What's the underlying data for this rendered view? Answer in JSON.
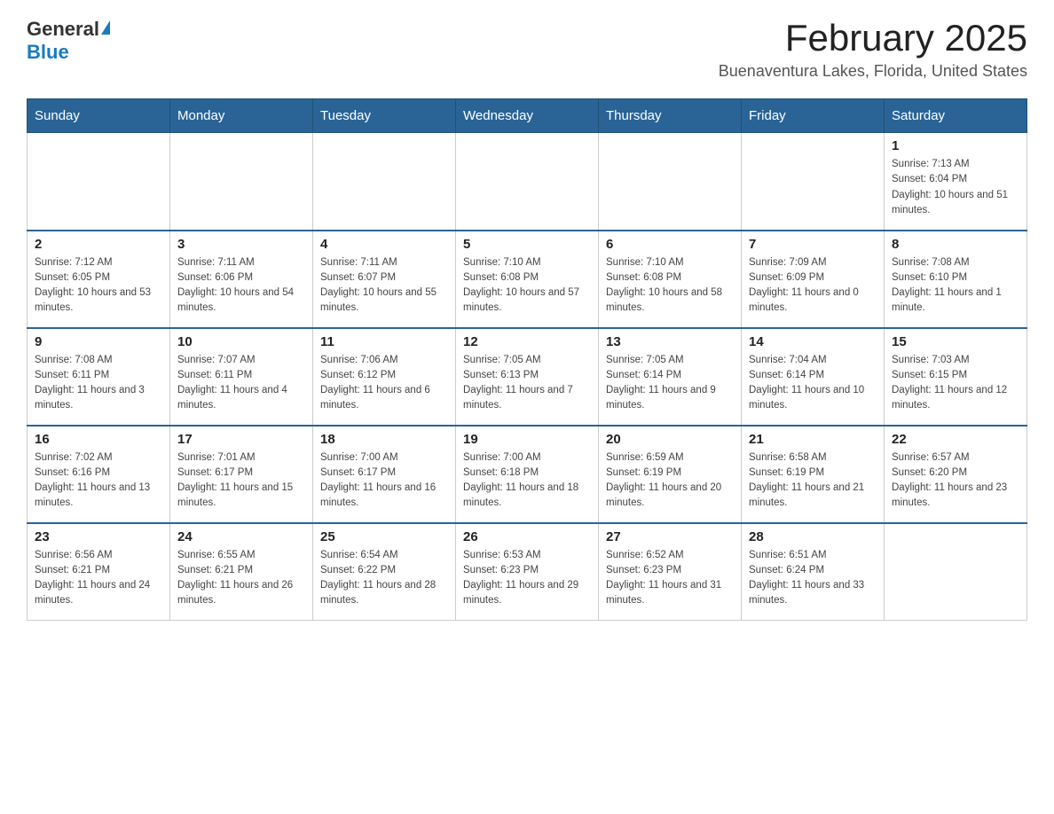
{
  "header": {
    "logo_general": "General",
    "logo_blue": "Blue",
    "title": "February 2025",
    "subtitle": "Buenaventura Lakes, Florida, United States"
  },
  "days_of_week": [
    "Sunday",
    "Monday",
    "Tuesday",
    "Wednesday",
    "Thursday",
    "Friday",
    "Saturday"
  ],
  "weeks": [
    [
      {
        "day": "",
        "sunrise": "",
        "sunset": "",
        "daylight": ""
      },
      {
        "day": "",
        "sunrise": "",
        "sunset": "",
        "daylight": ""
      },
      {
        "day": "",
        "sunrise": "",
        "sunset": "",
        "daylight": ""
      },
      {
        "day": "",
        "sunrise": "",
        "sunset": "",
        "daylight": ""
      },
      {
        "day": "",
        "sunrise": "",
        "sunset": "",
        "daylight": ""
      },
      {
        "day": "",
        "sunrise": "",
        "sunset": "",
        "daylight": ""
      },
      {
        "day": "1",
        "sunrise": "Sunrise: 7:13 AM",
        "sunset": "Sunset: 6:04 PM",
        "daylight": "Daylight: 10 hours and 51 minutes."
      }
    ],
    [
      {
        "day": "2",
        "sunrise": "Sunrise: 7:12 AM",
        "sunset": "Sunset: 6:05 PM",
        "daylight": "Daylight: 10 hours and 53 minutes."
      },
      {
        "day": "3",
        "sunrise": "Sunrise: 7:11 AM",
        "sunset": "Sunset: 6:06 PM",
        "daylight": "Daylight: 10 hours and 54 minutes."
      },
      {
        "day": "4",
        "sunrise": "Sunrise: 7:11 AM",
        "sunset": "Sunset: 6:07 PM",
        "daylight": "Daylight: 10 hours and 55 minutes."
      },
      {
        "day": "5",
        "sunrise": "Sunrise: 7:10 AM",
        "sunset": "Sunset: 6:08 PM",
        "daylight": "Daylight: 10 hours and 57 minutes."
      },
      {
        "day": "6",
        "sunrise": "Sunrise: 7:10 AM",
        "sunset": "Sunset: 6:08 PM",
        "daylight": "Daylight: 10 hours and 58 minutes."
      },
      {
        "day": "7",
        "sunrise": "Sunrise: 7:09 AM",
        "sunset": "Sunset: 6:09 PM",
        "daylight": "Daylight: 11 hours and 0 minutes."
      },
      {
        "day": "8",
        "sunrise": "Sunrise: 7:08 AM",
        "sunset": "Sunset: 6:10 PM",
        "daylight": "Daylight: 11 hours and 1 minute."
      }
    ],
    [
      {
        "day": "9",
        "sunrise": "Sunrise: 7:08 AM",
        "sunset": "Sunset: 6:11 PM",
        "daylight": "Daylight: 11 hours and 3 minutes."
      },
      {
        "day": "10",
        "sunrise": "Sunrise: 7:07 AM",
        "sunset": "Sunset: 6:11 PM",
        "daylight": "Daylight: 11 hours and 4 minutes."
      },
      {
        "day": "11",
        "sunrise": "Sunrise: 7:06 AM",
        "sunset": "Sunset: 6:12 PM",
        "daylight": "Daylight: 11 hours and 6 minutes."
      },
      {
        "day": "12",
        "sunrise": "Sunrise: 7:05 AM",
        "sunset": "Sunset: 6:13 PM",
        "daylight": "Daylight: 11 hours and 7 minutes."
      },
      {
        "day": "13",
        "sunrise": "Sunrise: 7:05 AM",
        "sunset": "Sunset: 6:14 PM",
        "daylight": "Daylight: 11 hours and 9 minutes."
      },
      {
        "day": "14",
        "sunrise": "Sunrise: 7:04 AM",
        "sunset": "Sunset: 6:14 PM",
        "daylight": "Daylight: 11 hours and 10 minutes."
      },
      {
        "day": "15",
        "sunrise": "Sunrise: 7:03 AM",
        "sunset": "Sunset: 6:15 PM",
        "daylight": "Daylight: 11 hours and 12 minutes."
      }
    ],
    [
      {
        "day": "16",
        "sunrise": "Sunrise: 7:02 AM",
        "sunset": "Sunset: 6:16 PM",
        "daylight": "Daylight: 11 hours and 13 minutes."
      },
      {
        "day": "17",
        "sunrise": "Sunrise: 7:01 AM",
        "sunset": "Sunset: 6:17 PM",
        "daylight": "Daylight: 11 hours and 15 minutes."
      },
      {
        "day": "18",
        "sunrise": "Sunrise: 7:00 AM",
        "sunset": "Sunset: 6:17 PM",
        "daylight": "Daylight: 11 hours and 16 minutes."
      },
      {
        "day": "19",
        "sunrise": "Sunrise: 7:00 AM",
        "sunset": "Sunset: 6:18 PM",
        "daylight": "Daylight: 11 hours and 18 minutes."
      },
      {
        "day": "20",
        "sunrise": "Sunrise: 6:59 AM",
        "sunset": "Sunset: 6:19 PM",
        "daylight": "Daylight: 11 hours and 20 minutes."
      },
      {
        "day": "21",
        "sunrise": "Sunrise: 6:58 AM",
        "sunset": "Sunset: 6:19 PM",
        "daylight": "Daylight: 11 hours and 21 minutes."
      },
      {
        "day": "22",
        "sunrise": "Sunrise: 6:57 AM",
        "sunset": "Sunset: 6:20 PM",
        "daylight": "Daylight: 11 hours and 23 minutes."
      }
    ],
    [
      {
        "day": "23",
        "sunrise": "Sunrise: 6:56 AM",
        "sunset": "Sunset: 6:21 PM",
        "daylight": "Daylight: 11 hours and 24 minutes."
      },
      {
        "day": "24",
        "sunrise": "Sunrise: 6:55 AM",
        "sunset": "Sunset: 6:21 PM",
        "daylight": "Daylight: 11 hours and 26 minutes."
      },
      {
        "day": "25",
        "sunrise": "Sunrise: 6:54 AM",
        "sunset": "Sunset: 6:22 PM",
        "daylight": "Daylight: 11 hours and 28 minutes."
      },
      {
        "day": "26",
        "sunrise": "Sunrise: 6:53 AM",
        "sunset": "Sunset: 6:23 PM",
        "daylight": "Daylight: 11 hours and 29 minutes."
      },
      {
        "day": "27",
        "sunrise": "Sunrise: 6:52 AM",
        "sunset": "Sunset: 6:23 PM",
        "daylight": "Daylight: 11 hours and 31 minutes."
      },
      {
        "day": "28",
        "sunrise": "Sunrise: 6:51 AM",
        "sunset": "Sunset: 6:24 PM",
        "daylight": "Daylight: 11 hours and 33 minutes."
      },
      {
        "day": "",
        "sunrise": "",
        "sunset": "",
        "daylight": ""
      }
    ]
  ]
}
